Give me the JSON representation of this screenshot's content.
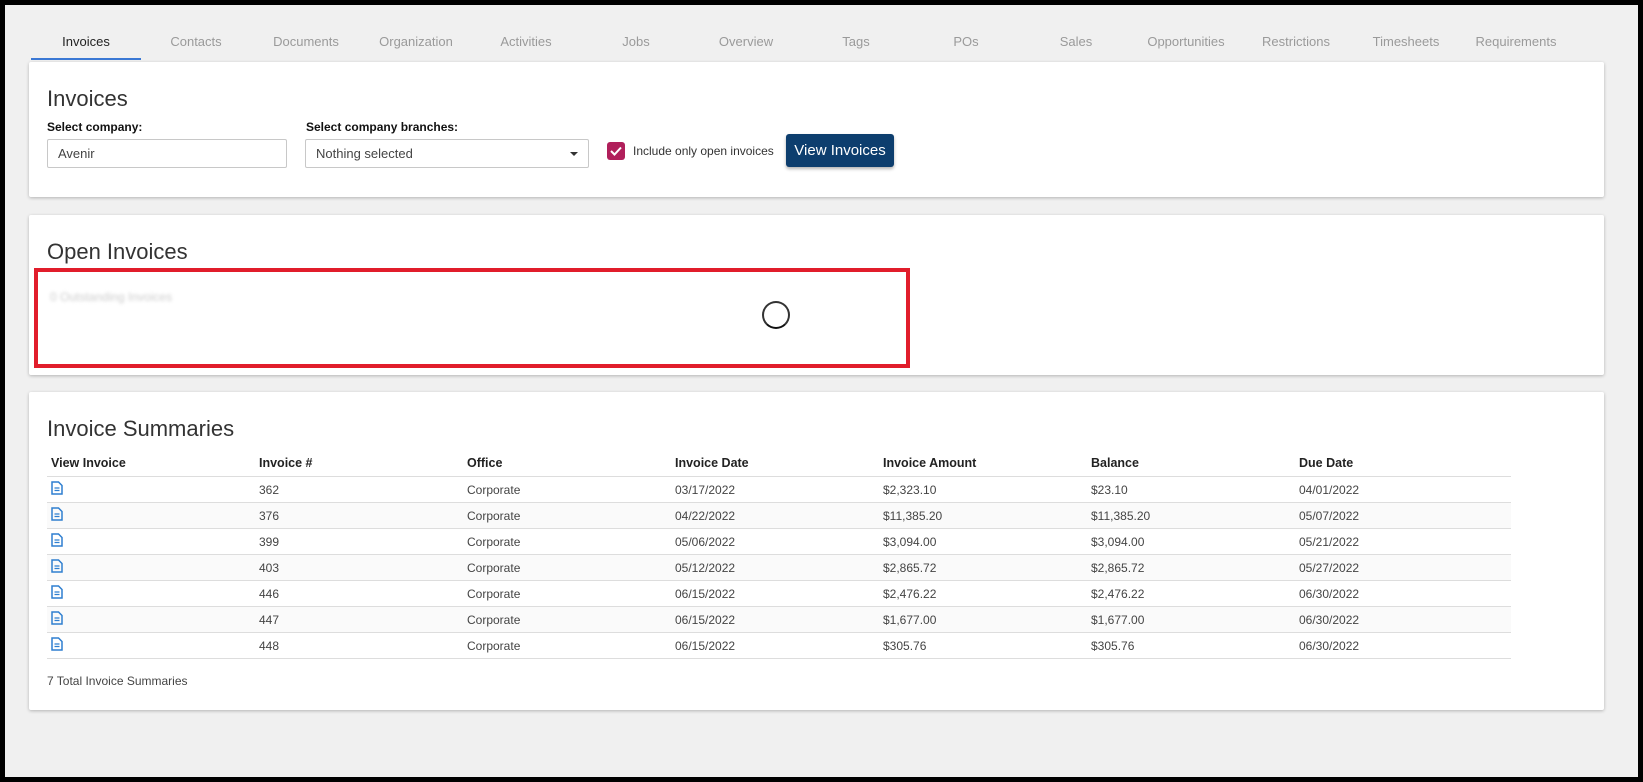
{
  "tabs": [
    {
      "label": "Invoices",
      "active": true
    },
    {
      "label": "Contacts"
    },
    {
      "label": "Documents"
    },
    {
      "label": "Organization"
    },
    {
      "label": "Activities"
    },
    {
      "label": "Jobs"
    },
    {
      "label": "Overview"
    },
    {
      "label": "Tags"
    },
    {
      "label": "POs"
    },
    {
      "label": "Sales"
    },
    {
      "label": "Opportunities"
    },
    {
      "label": "Restrictions"
    },
    {
      "label": "Timesheets"
    },
    {
      "label": "Requirements"
    }
  ],
  "invoices_card": {
    "title": "Invoices",
    "company_label": "Select company:",
    "company_value": "Avenir",
    "branches_label": "Select company branches:",
    "branches_value": "Nothing selected",
    "open_only_label": "Include only open invoices",
    "open_only_checked": true,
    "view_button": "View Invoices"
  },
  "open_invoices": {
    "title": "Open Invoices",
    "status_text": "0 Outstanding Invoices"
  },
  "summaries": {
    "title": "Invoice Summaries",
    "columns": [
      "View Invoice",
      "Invoice #",
      "Office",
      "Invoice Date",
      "Invoice Amount",
      "Balance",
      "Due Date"
    ],
    "rows": [
      {
        "invoice": "362",
        "office": "Corporate",
        "date": "03/17/2022",
        "amount": "$2,323.10",
        "balance": "$23.10",
        "due": "04/01/2022"
      },
      {
        "invoice": "376",
        "office": "Corporate",
        "date": "04/22/2022",
        "amount": "$11,385.20",
        "balance": "$11,385.20",
        "due": "05/07/2022"
      },
      {
        "invoice": "399",
        "office": "Corporate",
        "date": "05/06/2022",
        "amount": "$3,094.00",
        "balance": "$3,094.00",
        "due": "05/21/2022"
      },
      {
        "invoice": "403",
        "office": "Corporate",
        "date": "05/12/2022",
        "amount": "$2,865.72",
        "balance": "$2,865.72",
        "due": "05/27/2022"
      },
      {
        "invoice": "446",
        "office": "Corporate",
        "date": "06/15/2022",
        "amount": "$2,476.22",
        "balance": "$2,476.22",
        "due": "06/30/2022"
      },
      {
        "invoice": "447",
        "office": "Corporate",
        "date": "06/15/2022",
        "amount": "$1,677.00",
        "balance": "$1,677.00",
        "due": "06/30/2022"
      },
      {
        "invoice": "448",
        "office": "Corporate",
        "date": "06/15/2022",
        "amount": "$305.76",
        "balance": "$305.76",
        "due": "06/30/2022"
      }
    ],
    "total_text": "7 Total Invoice Summaries"
  },
  "colors": {
    "accent": "#0d3e6e",
    "checkbox": "#b01f5b",
    "highlight": "#e11d2b",
    "icon": "#2f7fd0"
  }
}
